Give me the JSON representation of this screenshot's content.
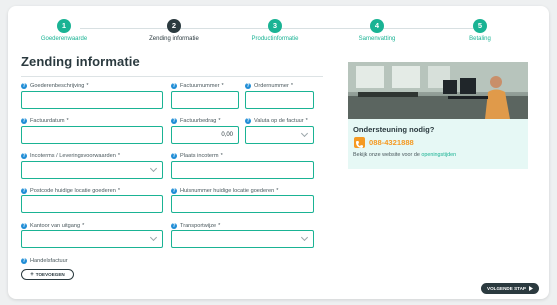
{
  "steps": [
    {
      "number": "1",
      "label": "Goederenwaarde",
      "state": "done"
    },
    {
      "number": "2",
      "label": "Zending informatie",
      "state": "active"
    },
    {
      "number": "3",
      "label": "Productinformatie",
      "state": "todo"
    },
    {
      "number": "4",
      "label": "Samenvatting",
      "state": "todo"
    },
    {
      "number": "5",
      "label": "Betaling",
      "state": "todo"
    }
  ],
  "form": {
    "title": "Zending informatie",
    "fields": {
      "goederenbeschrijving": {
        "label": "Goederenbeschrijving",
        "required": "*",
        "value": ""
      },
      "factuurnummer": {
        "label": "Factuurnummer",
        "required": "*",
        "value": ""
      },
      "ordernummer": {
        "label": "Ordernummer",
        "required": "*",
        "value": ""
      },
      "factuurdatum": {
        "label": "Factuurdatum",
        "required": "*",
        "value": ""
      },
      "factuurbedrag": {
        "label": "Factuurbedrag",
        "required": "*",
        "value": "0,00"
      },
      "valuta": {
        "label": "Valuta op de factuur",
        "required": "*",
        "value": ""
      },
      "incoterms": {
        "label": "Incoterms / Leveringsvoorwaarden",
        "required": "*",
        "value": ""
      },
      "plaats_incoterm": {
        "label": "Plaats incoterm",
        "required": "*",
        "value": ""
      },
      "postcode": {
        "label": "Postcode huidige locatie goederen",
        "required": "*",
        "value": ""
      },
      "huisnummer": {
        "label": "Huisnummer huidige locatie goederen",
        "required": "*",
        "value": ""
      },
      "kantoor": {
        "label": "Kantoor van uitgang",
        "required": "*",
        "value": ""
      },
      "transportwijze": {
        "label": "Transportwijze",
        "required": "*",
        "value": ""
      },
      "handelsfactuur": {
        "label": "Handelsfactuur",
        "required": ""
      }
    },
    "upload_label": "TOEVOEGEN"
  },
  "support": {
    "title": "Ondersteuning nodig?",
    "phone": "088-4321888",
    "note_prefix": "Bekijk onze website voor de ",
    "note_link": "openingstijden"
  },
  "next_button": "VOLGENDE STAP",
  "colors": {
    "accent": "#1ab394",
    "dark": "#2b3a3f",
    "phone": "#f59a23",
    "help": "#1f8dd6"
  }
}
